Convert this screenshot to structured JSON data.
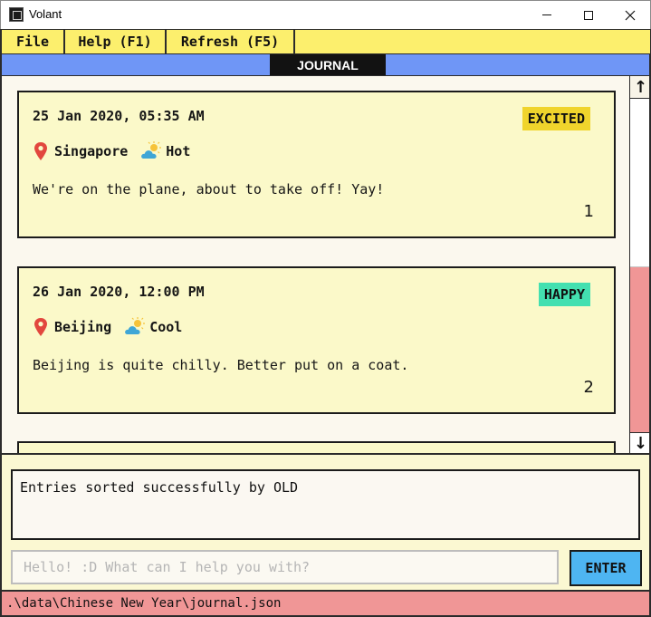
{
  "window": {
    "title": "Volant",
    "app_icon": "volant-app-icon",
    "controls": [
      "minimize",
      "maximize",
      "close"
    ]
  },
  "menu": {
    "items": [
      {
        "label": "File"
      },
      {
        "label": "Help (F1)"
      },
      {
        "label": "Refresh (F5)"
      }
    ]
  },
  "header": {
    "tab_label": "JOURNAL"
  },
  "entries": [
    {
      "datetime": "25 Jan 2020,  05:35 AM",
      "mood": "EXCITED",
      "location": "Singapore",
      "weather": "Hot",
      "text": "We're on the plane, about to take off! Yay!",
      "index": "1"
    },
    {
      "datetime": "26 Jan 2020,  12:00 PM",
      "mood": "HAPPY",
      "location": "Beijing",
      "weather": "Cool",
      "text": "Beijing is quite chilly. Better put on a coat.",
      "index": "2"
    }
  ],
  "result": {
    "message": "Entries sorted successfully by OLD"
  },
  "command": {
    "placeholder": "Hello! :D What can I help you with?",
    "value": "",
    "enter_label": "ENTER"
  },
  "status": {
    "file_path": ".\\data\\Chinese New Year\\journal.json"
  },
  "colors": {
    "menu_bg": "#fcef6d",
    "header_bg": "#6f96f6",
    "card_bg": "#fbf9c9",
    "mood_excited": "#f0d42c",
    "mood_happy": "#43e0b0",
    "scroll_thumb": "#f09696",
    "enter_button": "#4eb5f2",
    "status_bg": "#f09696"
  }
}
